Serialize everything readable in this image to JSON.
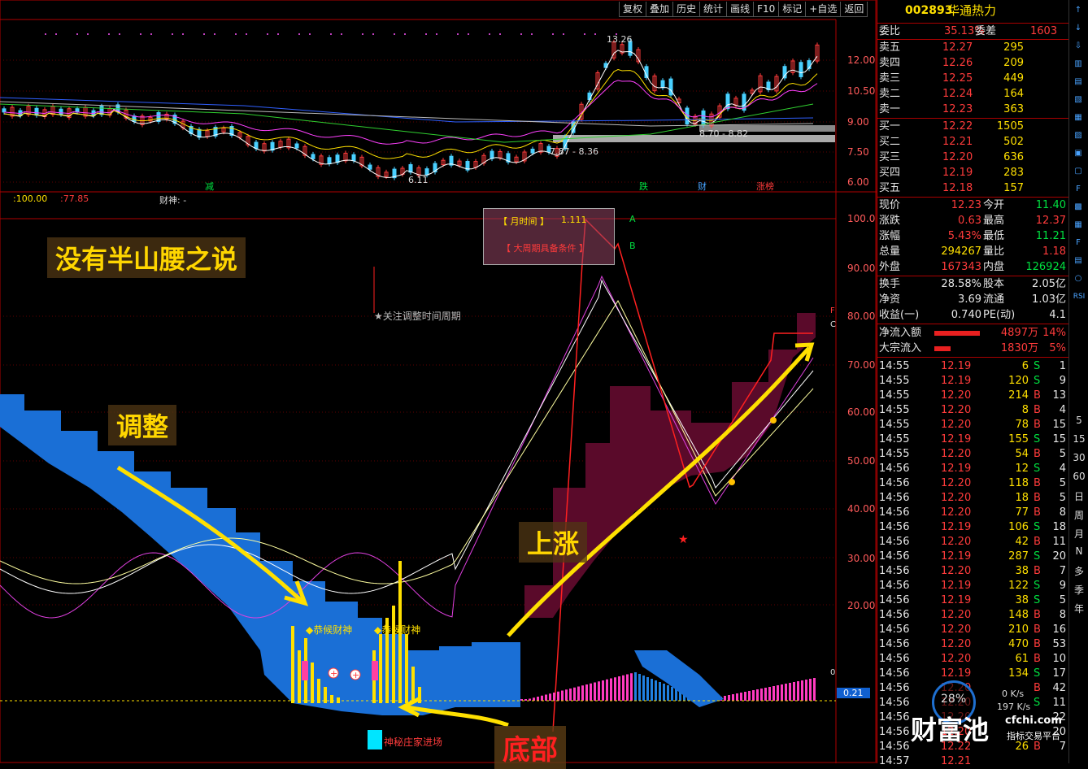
{
  "toolbar": {
    "buttons": [
      "复权",
      "叠加",
      "历史",
      "统计",
      "画线",
      "F10",
      "标记",
      "+自选",
      "返回"
    ]
  },
  "main_chart": {
    "high_label": "13.26",
    "low_label": "6.11",
    "low_range_label": "7.87 - 8.36",
    "right_range_label": "8.70 - 8.82",
    "price_axis": [
      "12.00",
      "10.50",
      "9.00",
      "7.50",
      "6.00"
    ],
    "event_marks": [
      {
        "text": "减",
        "color": "#00e040"
      },
      {
        "text": "跌",
        "color": "#00e040"
      },
      {
        "text": "财",
        "color": "#4aa3ff"
      },
      {
        "text": "涨榜",
        "color": "#ff3b3b"
      }
    ]
  },
  "indicator": {
    "header_val1": ":100.00",
    "header_val2": ":77.85",
    "header_label": "财神: -",
    "axis": [
      "100.0",
      "90.00",
      "80.00",
      "70.00",
      "60.00",
      "50.00",
      "40.00",
      "30.00",
      "20.00"
    ],
    "bottom_value": "0.21",
    "legend_line1": "【 月时间 】",
    "legend_line1_val": "1.111",
    "legend_line2": "【 大周期具备条件 】",
    "legend_a": "A",
    "legend_b": "B",
    "note": "★关注调整时间周期",
    "signal1": "◆恭候财神",
    "signal2": "◆恭候财神",
    "zhuangjia": "神秘庄家进场",
    "zero_marker": "0",
    "right_label_f": "F",
    "right_label_c": "C"
  },
  "annotations": {
    "title": "没有半山腰之说",
    "adjust": "调整",
    "rise": "上涨",
    "bottom": "底部"
  },
  "quote": {
    "code": "002893",
    "name": "华通热力",
    "weibi_label": "委比",
    "weibi": "35.13%",
    "weicha_label": "委差",
    "weicha": "1603",
    "sells": [
      {
        "label": "卖五",
        "price": "12.27",
        "vol": "295"
      },
      {
        "label": "卖四",
        "price": "12.26",
        "vol": "209"
      },
      {
        "label": "卖三",
        "price": "12.25",
        "vol": "449"
      },
      {
        "label": "卖二",
        "price": "12.24",
        "vol": "164"
      },
      {
        "label": "卖一",
        "price": "12.23",
        "vol": "363"
      }
    ],
    "buys": [
      {
        "label": "买一",
        "price": "12.22",
        "vol": "1505"
      },
      {
        "label": "买二",
        "price": "12.21",
        "vol": "502"
      },
      {
        "label": "买三",
        "price": "12.20",
        "vol": "636"
      },
      {
        "label": "买四",
        "price": "12.19",
        "vol": "283"
      },
      {
        "label": "买五",
        "price": "12.18",
        "vol": "157"
      }
    ],
    "stats": [
      {
        "l1": "现价",
        "v1": "12.23",
        "c1": "red",
        "l2": "今开",
        "v2": "11.40",
        "c2": "green"
      },
      {
        "l1": "涨跌",
        "v1": "0.63",
        "c1": "red",
        "l2": "最高",
        "v2": "12.37",
        "c2": "red"
      },
      {
        "l1": "涨幅",
        "v1": "5.43%",
        "c1": "red",
        "l2": "最低",
        "v2": "11.21",
        "c2": "green"
      },
      {
        "l1": "总量",
        "v1": "294267",
        "c1": "yellow",
        "l2": "量比",
        "v2": "1.18",
        "c2": "red"
      },
      {
        "l1": "外盘",
        "v1": "167343",
        "c1": "red",
        "l2": "内盘",
        "v2": "126924",
        "c2": "green"
      }
    ],
    "stats2": [
      {
        "l1": "换手",
        "v1": "28.58%",
        "l2": "股本",
        "v2": "2.05亿"
      },
      {
        "l1": "净资",
        "v1": "3.69",
        "l2": "流通",
        "v2": "1.03亿"
      },
      {
        "l1": "收益(一)",
        "v1": "0.740",
        "l2": "PE(动)",
        "v2": "4.1"
      }
    ],
    "flows": [
      {
        "label": "净流入额",
        "val": "4897万",
        "pct": "14%",
        "ratio": 0.14
      },
      {
        "label": "大宗流入",
        "val": "1830万",
        "pct": "5%",
        "ratio": 0.05
      }
    ],
    "ticks": [
      {
        "t": "14:55",
        "p": "12.19",
        "v": "6",
        "s": "S",
        "n": "1"
      },
      {
        "t": "14:55",
        "p": "12.19",
        "v": "120",
        "s": "S",
        "n": "9"
      },
      {
        "t": "14:55",
        "p": "12.20",
        "v": "214",
        "s": "B",
        "n": "13"
      },
      {
        "t": "14:55",
        "p": "12.20",
        "v": "8",
        "s": "B",
        "n": "4"
      },
      {
        "t": "14:55",
        "p": "12.20",
        "v": "78",
        "s": "B",
        "n": "15"
      },
      {
        "t": "14:55",
        "p": "12.19",
        "v": "155",
        "s": "S",
        "n": "15"
      },
      {
        "t": "14:55",
        "p": "12.20",
        "v": "54",
        "s": "B",
        "n": "5"
      },
      {
        "t": "14:56",
        "p": "12.19",
        "v": "12",
        "s": "S",
        "n": "4"
      },
      {
        "t": "14:56",
        "p": "12.20",
        "v": "118",
        "s": "B",
        "n": "5"
      },
      {
        "t": "14:56",
        "p": "12.20",
        "v": "18",
        "s": "B",
        "n": "5"
      },
      {
        "t": "14:56",
        "p": "12.20",
        "v": "77",
        "s": "B",
        "n": "8"
      },
      {
        "t": "14:56",
        "p": "12.19",
        "v": "106",
        "s": "S",
        "n": "18"
      },
      {
        "t": "14:56",
        "p": "12.20",
        "v": "42",
        "s": "B",
        "n": "11"
      },
      {
        "t": "14:56",
        "p": "12.19",
        "v": "287",
        "s": "S",
        "n": "20"
      },
      {
        "t": "14:56",
        "p": "12.20",
        "v": "38",
        "s": "B",
        "n": "7"
      },
      {
        "t": "14:56",
        "p": "12.19",
        "v": "122",
        "s": "S",
        "n": "9"
      },
      {
        "t": "14:56",
        "p": "12.19",
        "v": "38",
        "s": "S",
        "n": "5"
      },
      {
        "t": "14:56",
        "p": "12.20",
        "v": "148",
        "s": "B",
        "n": "8"
      },
      {
        "t": "14:56",
        "p": "12.20",
        "v": "210",
        "s": "B",
        "n": "16"
      },
      {
        "t": "14:56",
        "p": "12.20",
        "v": "470",
        "s": "B",
        "n": "53"
      },
      {
        "t": "14:56",
        "p": "12.20",
        "v": "61",
        "s": "B",
        "n": "10"
      },
      {
        "t": "14:56",
        "p": "12.19",
        "v": "134",
        "s": "S",
        "n": "17"
      },
      {
        "t": "14:56",
        "p": "12.20",
        "v": "",
        "s": "B",
        "n": "42"
      },
      {
        "t": "14:56",
        "p": "12.20",
        "v": "",
        "s": "S",
        "n": "11"
      },
      {
        "t": "14:56",
        "p": "12.20",
        "v": "",
        "s": "",
        "n": "22"
      },
      {
        "t": "14:56",
        "p": "12.20",
        "v": "",
        "s": "",
        "n": "20"
      },
      {
        "t": "14:56",
        "p": "12.22",
        "v": "26",
        "s": "B",
        "n": "7"
      },
      {
        "t": "14:57",
        "p": "12.21",
        "v": "",
        "s": "",
        "n": ""
      }
    ]
  },
  "sidebar": {
    "labels": [
      "5",
      "15",
      "30",
      "60",
      "日",
      "周",
      "月",
      "N",
      "多",
      "季",
      "年"
    ],
    "rsi_label": "RSI"
  },
  "logo": {
    "name": "财富池",
    "site": "cfchi.com",
    "slogan": "指标交易平台",
    "pct": "28%",
    "speed1": "0 K/s",
    "speed2": "197 K/s"
  },
  "colors": {
    "up": "#ff3b3b",
    "down": "#00e040",
    "blue_band": "#1a6fd6",
    "purple_band": "#5a0a2a",
    "accent": "#ffe000"
  }
}
